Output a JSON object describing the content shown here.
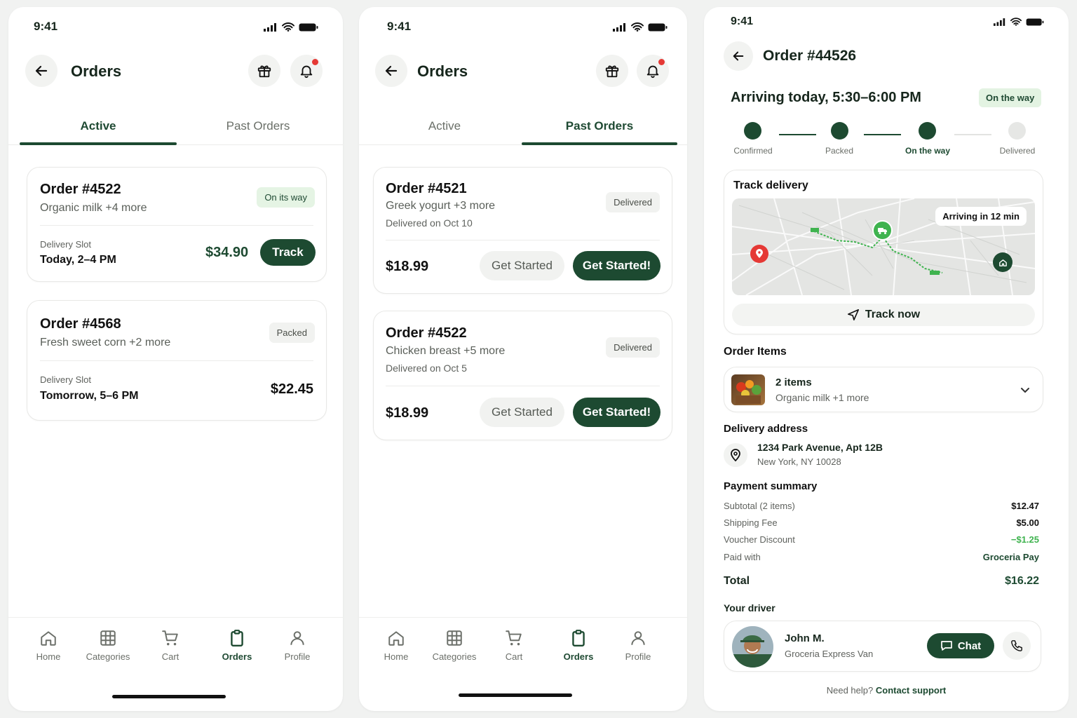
{
  "status_bar": {
    "time": "9:41"
  },
  "screen1": {
    "title": "Orders",
    "tabs": [
      {
        "label": "Active"
      },
      {
        "label": "Past Orders"
      }
    ],
    "orders": [
      {
        "id": "Order #4522",
        "items": "Organic milk +4 more",
        "badge": "On its way",
        "slot_label": "Delivery Slot",
        "slot": "Today, 2–4 PM",
        "price": "$34.90",
        "action": "Track"
      },
      {
        "id": "Order #4568",
        "items": "Fresh sweet corn +2 more",
        "badge": "Packed",
        "slot_label": "Delivery Slot",
        "slot": "Tomorrow, 5–6 PM",
        "price": "$22.45"
      }
    ]
  },
  "screen2": {
    "title": "Orders",
    "tabs": [
      {
        "label": "Active"
      },
      {
        "label": "Past Orders"
      }
    ],
    "orders": [
      {
        "id": "Order #4521",
        "items": "Greek yogurt +3 more",
        "date": "Delivered on Oct 10",
        "badge": "Delivered",
        "price": "$18.99",
        "secondary": "Get Started",
        "primary": "Get Started!"
      },
      {
        "id": "Order #4522",
        "items": "Chicken breast +5 more",
        "date": "Delivered on Oct 5",
        "badge": "Delivered",
        "price": "$18.99",
        "secondary": "Get Started",
        "primary": "Get Started!"
      }
    ]
  },
  "nav": [
    {
      "label": "Home",
      "icon": "home-icon"
    },
    {
      "label": "Categories",
      "icon": "grid-icon"
    },
    {
      "label": "Cart",
      "icon": "cart-icon"
    },
    {
      "label": "Orders",
      "icon": "clipboard-icon"
    },
    {
      "label": "Profile",
      "icon": "user-icon"
    }
  ],
  "screen3": {
    "title": "Order #44526",
    "arriving": "Arriving today, 5:30–6:00 PM",
    "status_badge": "On the way",
    "steps": [
      {
        "label": "Confirmed",
        "done": true
      },
      {
        "label": "Packed",
        "done": true
      },
      {
        "label": "On the way",
        "done": true
      },
      {
        "label": "Delivered",
        "done": false
      }
    ],
    "track": {
      "title": "Track delivery",
      "eta": "Arriving in 12 min",
      "button": "Track now"
    },
    "order_items": {
      "title": "Order Items",
      "count": "2 items",
      "summary": "Organic milk +1 more"
    },
    "address": {
      "title": "Delivery address",
      "line1": "1234 Park Avenue, Apt 12B",
      "line2": "New York, NY 10028"
    },
    "payment": {
      "title": "Payment summary",
      "rows": [
        {
          "label": "Subtotal (2 items)",
          "value": "$12.47"
        },
        {
          "label": "Shipping Fee",
          "value": "$5.00"
        },
        {
          "label": "Voucher Discount",
          "value": "−$1.25"
        },
        {
          "label": "Paid with",
          "value": "Groceria Pay"
        }
      ],
      "total_label": "Total",
      "total": "$16.22"
    },
    "driver": {
      "title": "Your driver",
      "name": "John M.",
      "vehicle": "Groceria Express Van",
      "chat": "Chat"
    },
    "help": {
      "text": "Need help?",
      "link": "Contact support"
    }
  },
  "colors": {
    "primary": "#1d4a31",
    "accent_green": "#3fb34f",
    "alert": "#e53935"
  }
}
